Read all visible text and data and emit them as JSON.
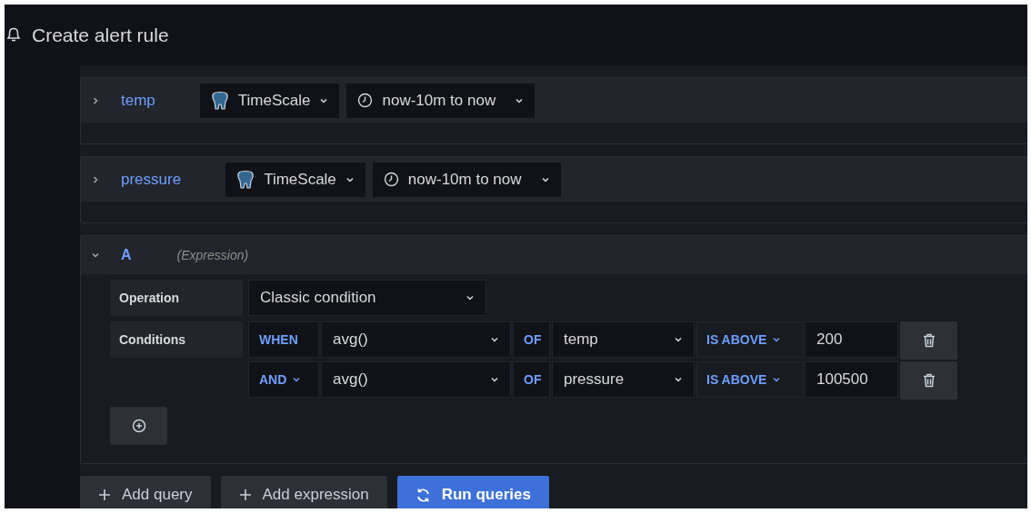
{
  "header": {
    "title": "Create alert rule"
  },
  "queries": [
    {
      "name": "temp",
      "expanded": false,
      "datasource": "TimeScale",
      "time_range": "now-10m to now"
    },
    {
      "name": "pressure",
      "expanded": false,
      "datasource": "TimeScale",
      "time_range": "now-10m to now"
    }
  ],
  "expression": {
    "name": "A",
    "type": "(Expression)",
    "expanded": true,
    "operation": {
      "label": "Operation",
      "value": "Classic condition"
    },
    "conditions": {
      "label": "Conditions",
      "rows": [
        {
          "kind": "when",
          "operator": "WHEN",
          "reducer": "avg()",
          "of": "OF",
          "query": "temp",
          "evaluator": "IS ABOVE",
          "value": "200"
        },
        {
          "kind": "and",
          "operator": "AND",
          "reducer": "avg()",
          "of": "OF",
          "query": "pressure",
          "evaluator": "IS ABOVE",
          "value": "100500"
        }
      ]
    }
  },
  "actions": [
    {
      "kind": "add",
      "label": "Add query",
      "primary": false
    },
    {
      "kind": "add",
      "label": "Add expression",
      "primary": false
    },
    {
      "kind": "run",
      "label": "Run queries",
      "primary": true
    }
  ]
}
